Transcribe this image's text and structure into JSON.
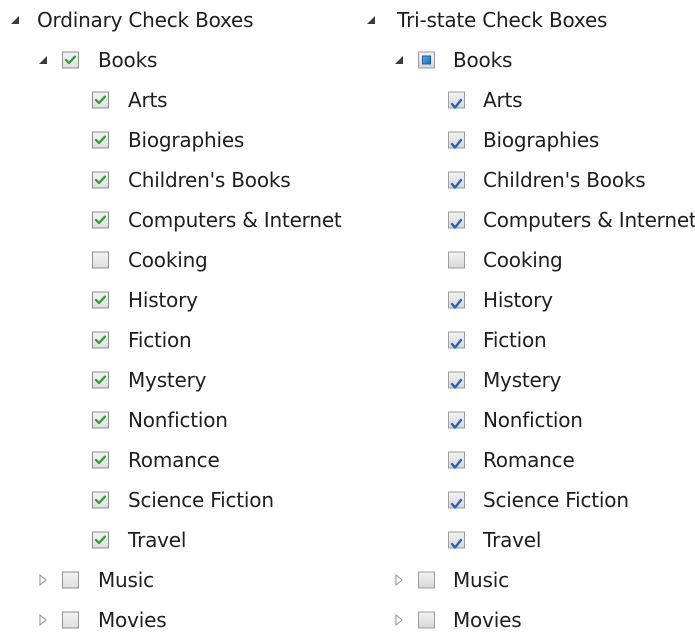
{
  "left_tree": {
    "title": "Ordinary Check Boxes",
    "root": {
      "label": "Books",
      "checked": true,
      "expanded": true
    },
    "children": [
      {
        "label": "Arts",
        "checked": true
      },
      {
        "label": "Biographies",
        "checked": true
      },
      {
        "label": "Children's Books",
        "checked": true
      },
      {
        "label": "Computers & Internet",
        "checked": true
      },
      {
        "label": "Cooking",
        "checked": false
      },
      {
        "label": "History",
        "checked": true
      },
      {
        "label": "Fiction",
        "checked": true
      },
      {
        "label": "Mystery",
        "checked": true
      },
      {
        "label": "Nonfiction",
        "checked": true
      },
      {
        "label": "Romance",
        "checked": true
      },
      {
        "label": "Science Fiction",
        "checked": true
      },
      {
        "label": "Travel",
        "checked": true
      }
    ],
    "siblings": [
      {
        "label": "Music",
        "checked": false,
        "expanded": false
      },
      {
        "label": "Movies",
        "checked": false,
        "expanded": false
      }
    ]
  },
  "right_tree": {
    "title": "Tri-state Check Boxes",
    "root": {
      "label": "Books",
      "state": "indeterminate",
      "expanded": true
    },
    "children": [
      {
        "label": "Arts",
        "checked": true
      },
      {
        "label": "Biographies",
        "checked": true
      },
      {
        "label": "Children's Books",
        "checked": true
      },
      {
        "label": "Computers & Internet",
        "checked": true
      },
      {
        "label": "Cooking",
        "checked": false
      },
      {
        "label": "History",
        "checked": true
      },
      {
        "label": "Fiction",
        "checked": true
      },
      {
        "label": "Mystery",
        "checked": true
      },
      {
        "label": "Nonfiction",
        "checked": true
      },
      {
        "label": "Romance",
        "checked": true
      },
      {
        "label": "Science Fiction",
        "checked": true
      },
      {
        "label": "Travel",
        "checked": true
      }
    ],
    "siblings": [
      {
        "label": "Music",
        "checked": false,
        "expanded": false
      },
      {
        "label": "Movies",
        "checked": false,
        "expanded": false
      }
    ]
  },
  "colors": {
    "ordinary_check": "#2f9a3a",
    "tristate_check": "#2b5fb3",
    "indeterminate_fill": "#1f6fb8",
    "text": "#1e1e1e"
  }
}
